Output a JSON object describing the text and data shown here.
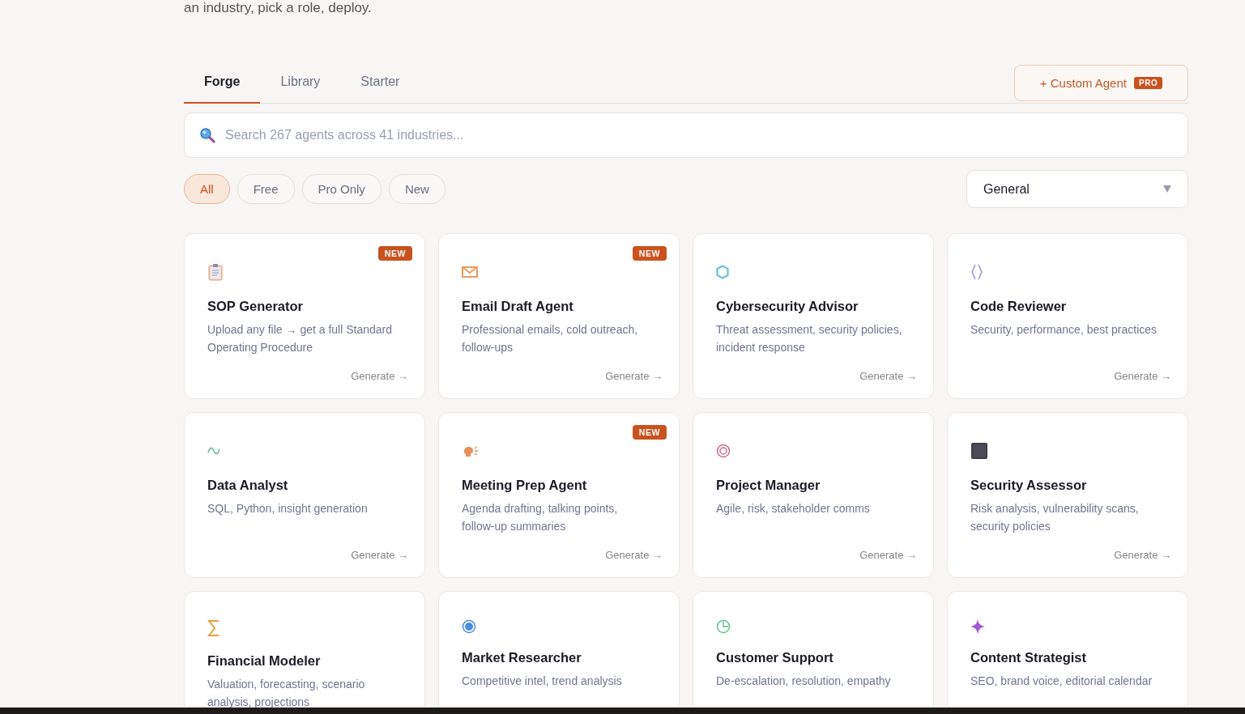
{
  "intro": "an industry, pick a role, deploy.",
  "tabs": [
    {
      "label": "Forge",
      "selected": true
    },
    {
      "label": "Library",
      "selected": false
    },
    {
      "label": "Starter",
      "selected": false
    }
  ],
  "custom_button": {
    "label": "+ Custom Agent",
    "badge": "PRO"
  },
  "search": {
    "placeholder": "Search 267 agents across 41 industries..."
  },
  "filters": [
    {
      "label": "All",
      "selected": true
    },
    {
      "label": "Free",
      "selected": false
    },
    {
      "label": "Pro Only",
      "selected": false
    },
    {
      "label": "New",
      "selected": false
    }
  ],
  "industry_select": {
    "value": "General"
  },
  "agents": [
    {
      "name": "SOP Generator",
      "description": "Upload any file → get a full Standard Operating Procedure",
      "badge": "NEW",
      "action": "Generate →"
    },
    {
      "name": "Email Draft Agent",
      "description": "Professional emails, cold outreach, follow-ups",
      "badge": "NEW",
      "action": "Generate →"
    },
    {
      "name": "Cybersecurity Advisor",
      "description": "Threat assessment, security policies, incident response",
      "action": "Generate →"
    },
    {
      "name": "Code Reviewer",
      "description": "Security, performance, best practices",
      "action": "Generate →"
    },
    {
      "name": "Data Analyst",
      "description": "SQL, Python, insight generation",
      "action": "Generate →"
    },
    {
      "name": "Meeting Prep Agent",
      "description": "Agenda drafting, talking points, follow-up summaries",
      "badge": "NEW",
      "action": "Generate →"
    },
    {
      "name": "Project Manager",
      "description": "Agile, risk, stakeholder comms",
      "action": "Generate →"
    },
    {
      "name": "Security Assessor",
      "description": "Risk analysis, vulnerability scans, security policies",
      "action": "Generate →"
    },
    {
      "name": "Financial Modeler",
      "description": "Valuation, forecasting, scenario analysis, projections"
    },
    {
      "name": "Market Researcher",
      "description": "Competitive intel, trend analysis"
    },
    {
      "name": "Customer Support",
      "description": "De-escalation, resolution, empathy"
    },
    {
      "name": "Content Strategist",
      "description": "SEO, brand voice, editorial calendar"
    }
  ]
}
